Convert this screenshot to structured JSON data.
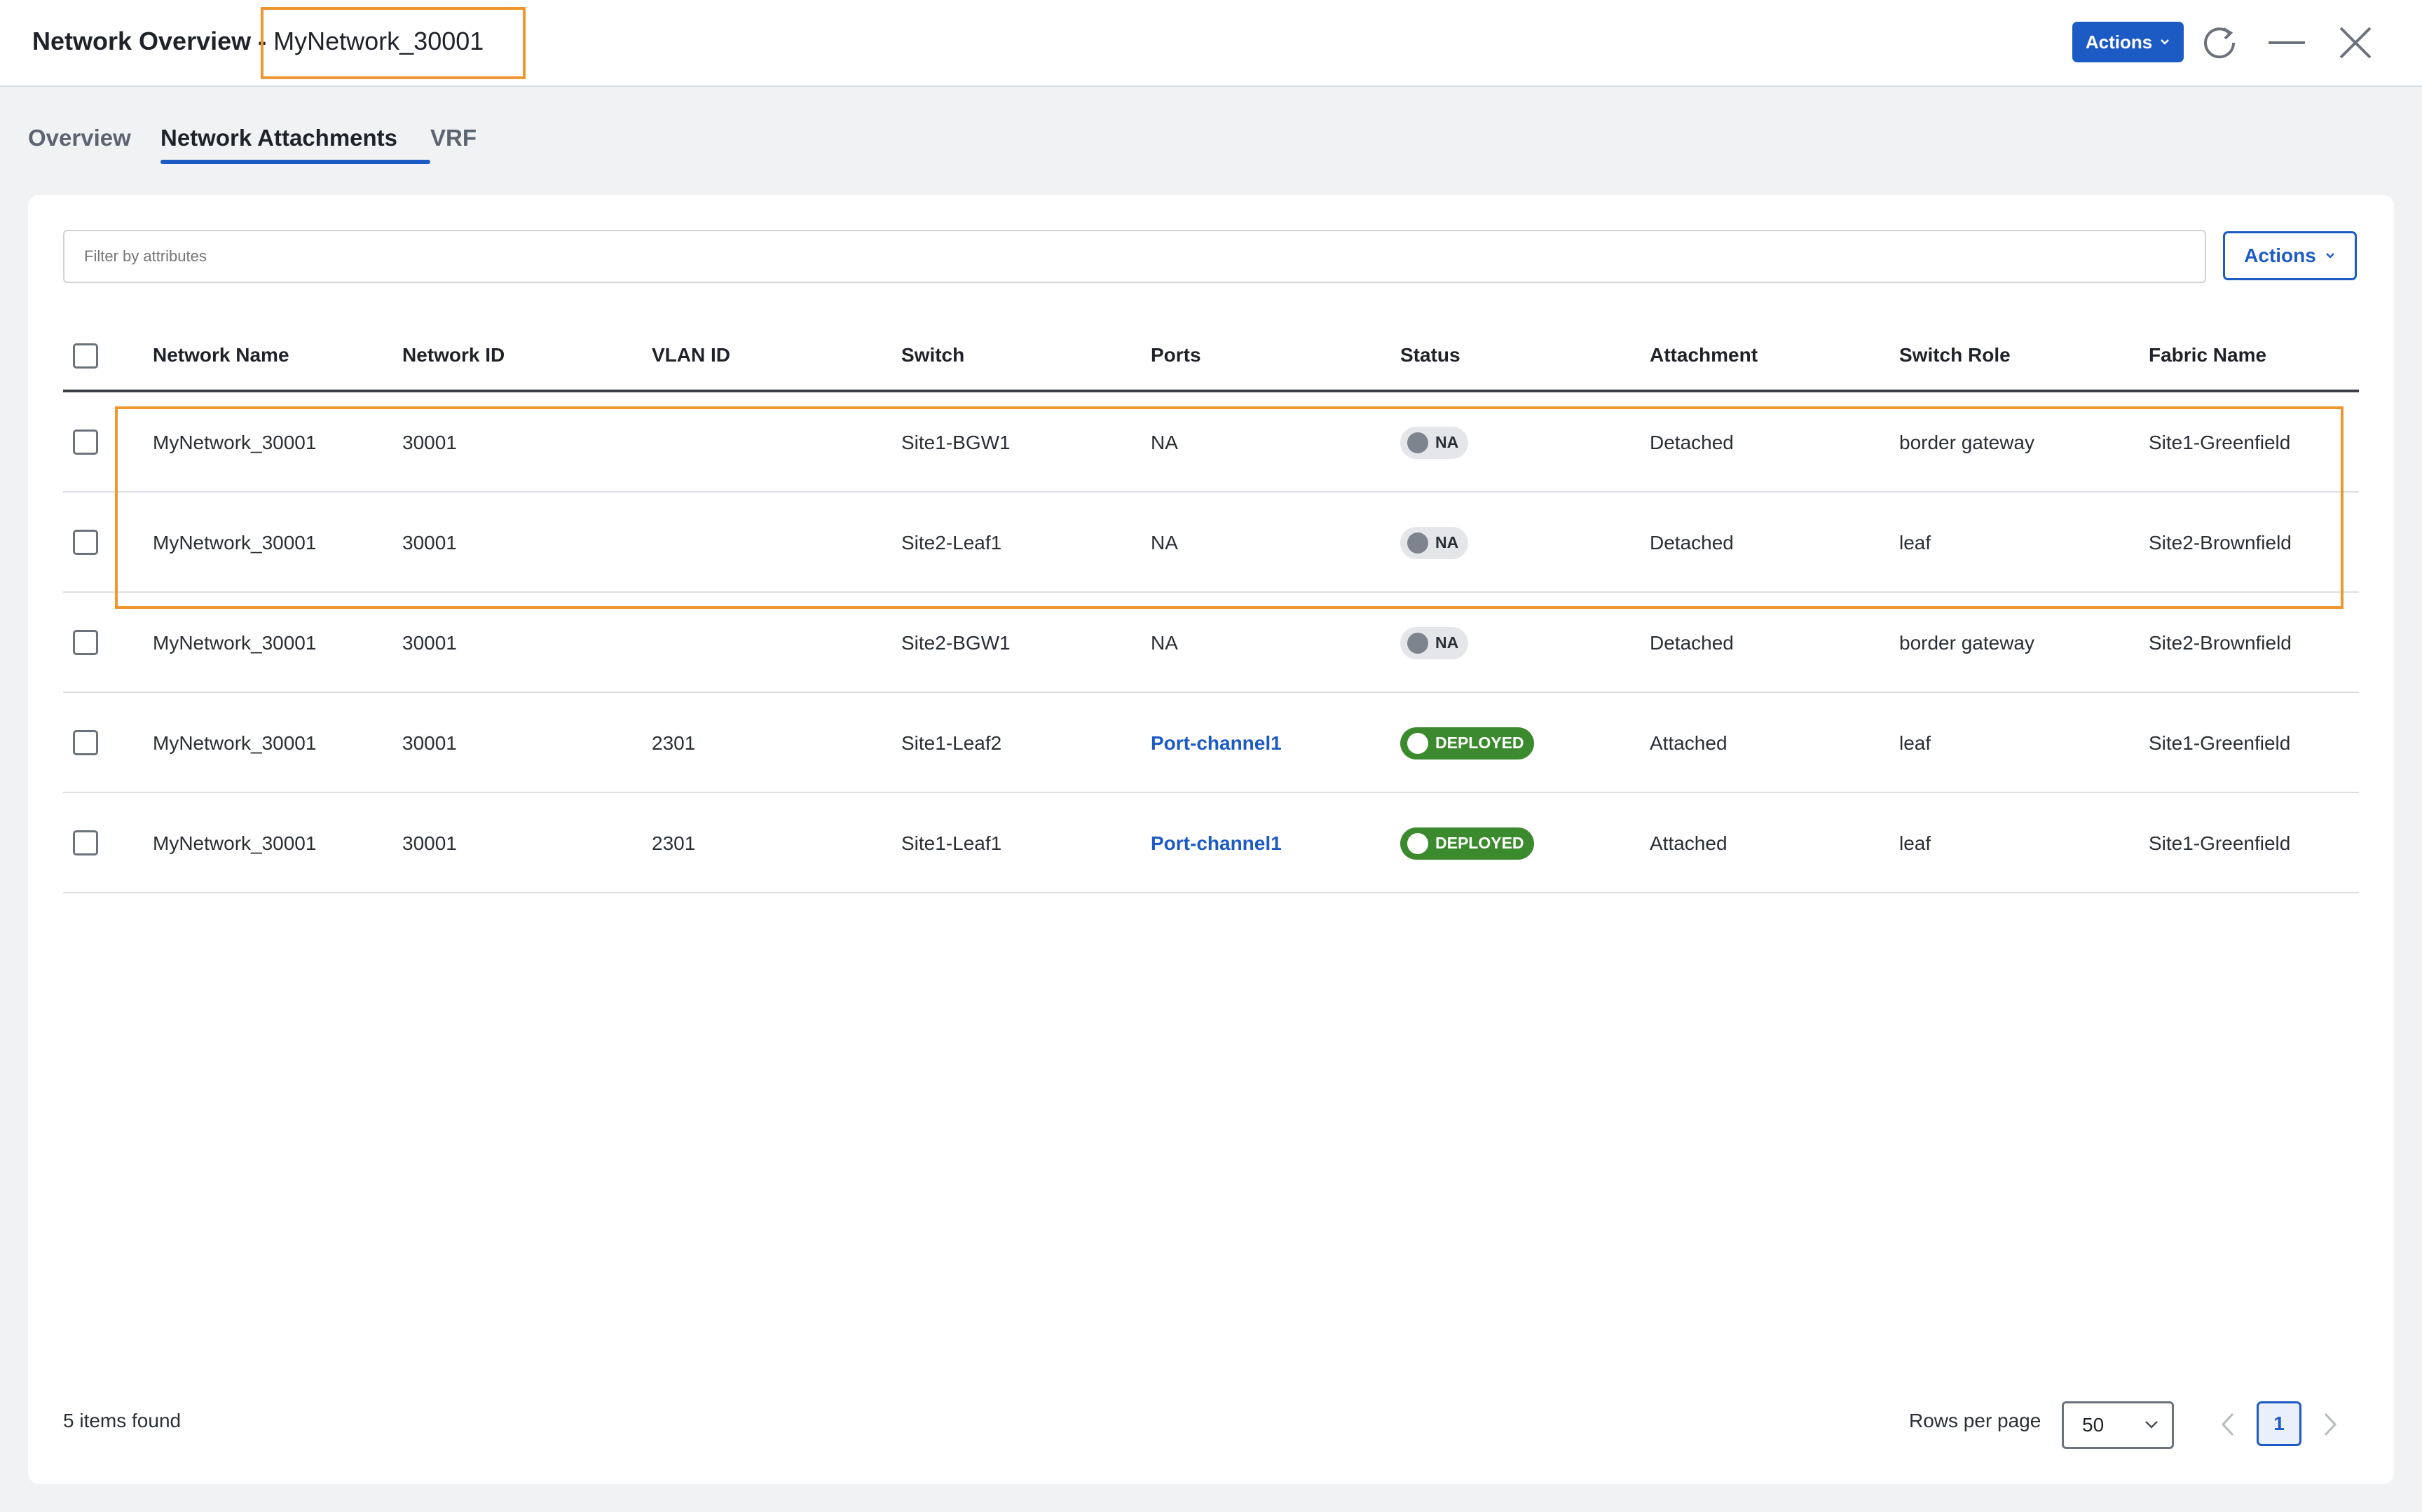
{
  "header": {
    "title_prefix": "Network Overview - ",
    "title_network": "MyNetwork_30001",
    "actions_label": "Actions"
  },
  "tabs": [
    {
      "label": "Overview"
    },
    {
      "label": "Network Attachments",
      "active": true
    },
    {
      "label": "VRF"
    }
  ],
  "filter": {
    "placeholder": "Filter by attributes"
  },
  "card_actions_label": "Actions",
  "table": {
    "columns": [
      "Network Name",
      "Network ID",
      "VLAN ID",
      "Switch",
      "Ports",
      "Status",
      "Attachment",
      "Switch Role",
      "Fabric Name"
    ],
    "rows": [
      {
        "network_name": "MyNetwork_30001",
        "network_id": "30001",
        "vlan_id": "",
        "switch": "Site1-BGW1",
        "ports": "NA",
        "status": "NA",
        "attachment": "Detached",
        "switch_role": "border gateway",
        "fabric_name": "Site1-Greenfield"
      },
      {
        "network_name": "MyNetwork_30001",
        "network_id": "30001",
        "vlan_id": "",
        "switch": "Site2-Leaf1",
        "ports": "NA",
        "status": "NA",
        "attachment": "Detached",
        "switch_role": "leaf",
        "fabric_name": "Site2-Brownfield"
      },
      {
        "network_name": "MyNetwork_30001",
        "network_id": "30001",
        "vlan_id": "",
        "switch": "Site2-BGW1",
        "ports": "NA",
        "status": "NA",
        "attachment": "Detached",
        "switch_role": "border gateway",
        "fabric_name": "Site2-Brownfield"
      },
      {
        "network_name": "MyNetwork_30001",
        "network_id": "30001",
        "vlan_id": "2301",
        "switch": "Site1-Leaf2",
        "ports": "Port-channel1",
        "status": "DEPLOYED",
        "attachment": "Attached",
        "switch_role": "leaf",
        "fabric_name": "Site1-Greenfield"
      },
      {
        "network_name": "MyNetwork_30001",
        "network_id": "30001",
        "vlan_id": "2301",
        "switch": "Site1-Leaf1",
        "ports": "Port-channel1",
        "status": "DEPLOYED",
        "attachment": "Attached",
        "switch_role": "leaf",
        "fabric_name": "Site1-Greenfield"
      }
    ]
  },
  "footer": {
    "items_found": "5 items found",
    "rows_per_page_label": "Rows per page",
    "rows_per_page_value": "50",
    "current_page": "1"
  },
  "colors": {
    "primary": "#1d5bc4",
    "deployed": "#3c8a2e",
    "highlight": "#f0962e"
  }
}
